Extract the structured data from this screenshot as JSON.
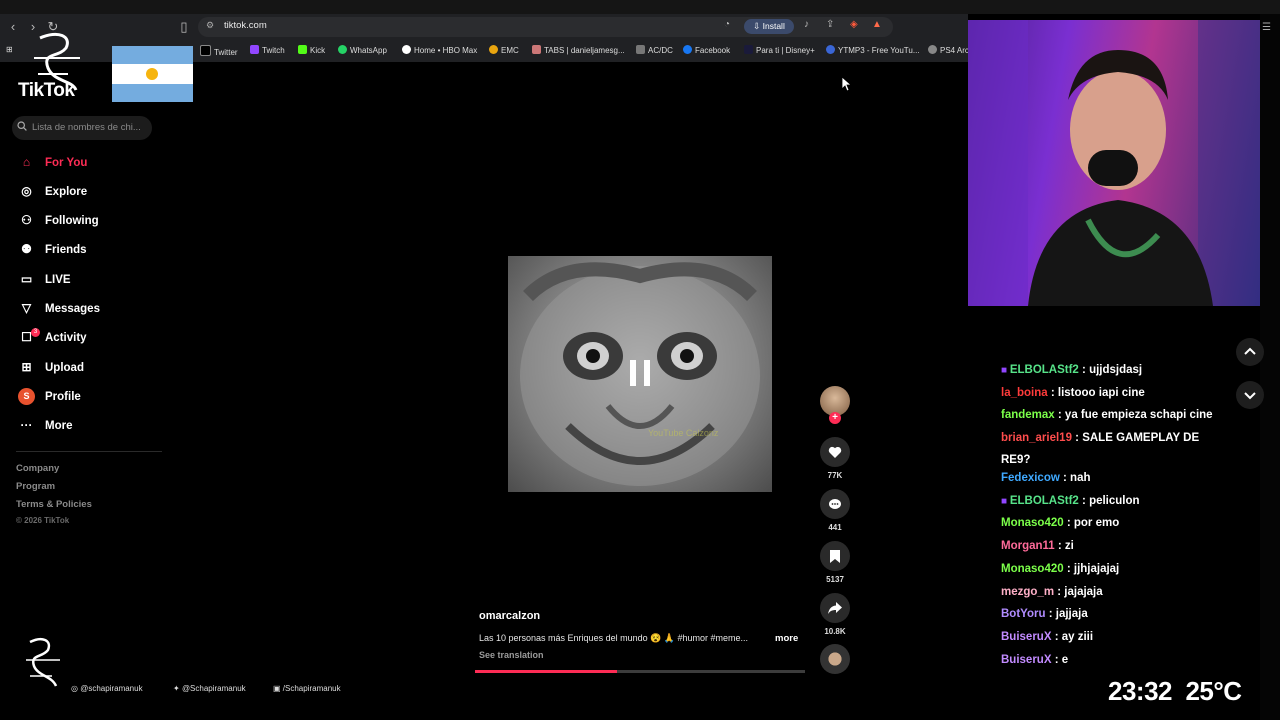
{
  "browser": {
    "url": "tiktok.com",
    "install_label": "Install",
    "bookmarks": [
      "Twitter",
      "Twitch",
      "Kick",
      "WhatsApp",
      "Home • HBO Max",
      "EMC",
      "TABS | danieljamesg...",
      "AC/DC",
      "Facebook",
      "Para ti | Disney+",
      "YTMP3 - Free YouTu...",
      "PS4 Arc"
    ]
  },
  "sidebar": {
    "logo": "TikTok",
    "search_placeholder": "Lista de nombres de chi...",
    "nav": [
      {
        "label": "For You",
        "icon": "home-icon",
        "active": true
      },
      {
        "label": "Explore",
        "icon": "compass-icon"
      },
      {
        "label": "Following",
        "icon": "following-icon"
      },
      {
        "label": "Friends",
        "icon": "friends-icon"
      },
      {
        "label": "LIVE",
        "icon": "live-icon"
      },
      {
        "label": "Messages",
        "icon": "messages-icon"
      },
      {
        "label": "Activity",
        "icon": "activity-icon",
        "badge": "3"
      },
      {
        "label": "Upload",
        "icon": "upload-icon"
      },
      {
        "label": "Profile",
        "icon": "profile-avatar",
        "avatar_letter": "S"
      },
      {
        "label": "More",
        "icon": "more-icon"
      }
    ],
    "footer": [
      "Company",
      "Program",
      "Terms & Policies"
    ],
    "copyright": "© 2026 TikTok"
  },
  "video": {
    "watermark": "YouTube Calzonz",
    "author": "omarcalzon",
    "caption": "Las 10 personas más Enriques del mundo 😵 🙏 #humor #meme...",
    "more_label": "more",
    "see_translation": "See translation",
    "progress": 0.43,
    "likes": "77K",
    "comments": "441",
    "saves": "5137",
    "shares": "10.8K"
  },
  "chat": {
    "messages": [
      {
        "user": "ELBOLAStf2",
        "text": "ujjdsjdasj",
        "color": "#57e389",
        "badge": true
      },
      {
        "user": "la_boina",
        "text": "listooo iapi cine",
        "color": "#ff3b3b"
      },
      {
        "user": "fandemax",
        "text": "ya fue empieza schapi cine",
        "color": "#7cff4a"
      },
      {
        "user": "brian_ariel19",
        "text": "SALE GAMEPLAY DE RE9?",
        "color": "#ff4d4d"
      },
      {
        "user": "Fedexicow",
        "text": "nah",
        "color": "#3fa9ff"
      },
      {
        "user": "ELBOLAStf2",
        "text": "peliculon",
        "color": "#57e389",
        "badge": true
      },
      {
        "user": "Monaso420",
        "text": "por emo",
        "color": "#7cff4a"
      },
      {
        "user": "Morgan11",
        "text": "zi",
        "color": "#ff6b9a"
      },
      {
        "user": "Monaso420",
        "text": "jjhjajajaj",
        "color": "#7cff4a"
      },
      {
        "user": "mezgo_m",
        "text": "jajajaja",
        "color": "#ffb0c8"
      },
      {
        "user": "BotYoru",
        "text": "jajjaja",
        "color": "#b18cff"
      },
      {
        "user": "BuiseruX",
        "text": "ay ziii",
        "color": "#c28bff"
      },
      {
        "user": "BuiseruX",
        "text": "e",
        "color": "#c28bff"
      }
    ]
  },
  "overlay": {
    "time": "23:32",
    "temperature": "25°C",
    "socials": [
      "@schapiramanuk",
      "@Schapiramanuk",
      "/Schapiramanuk"
    ]
  }
}
